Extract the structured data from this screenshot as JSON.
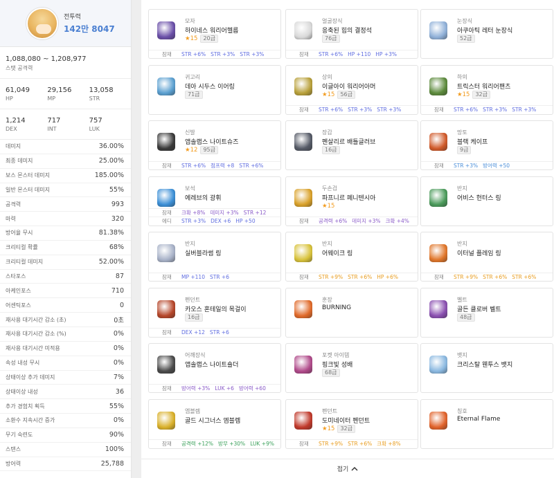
{
  "character": {
    "power_label": "전투력",
    "power_value": "142만 8047"
  },
  "stat_attack": {
    "value": "1,088,080 ~ 1,208,977",
    "label": "스탯 공격력"
  },
  "triples": [
    [
      {
        "value": "61,049",
        "label": "HP"
      },
      {
        "value": "29,156",
        "label": "MP"
      },
      {
        "value": "13,058",
        "label": "STR"
      }
    ],
    [
      {
        "value": "1,214",
        "label": "DEX"
      },
      {
        "value": "717",
        "label": "INT"
      },
      {
        "value": "757",
        "label": "LUK"
      }
    ]
  ],
  "stats": [
    {
      "k": "데미지",
      "v": "36.00%"
    },
    {
      "k": "최종 데미지",
      "v": "25.00%"
    },
    {
      "k": "보스 몬스터 데미지",
      "v": "185.00%"
    },
    {
      "k": "일반 몬스터 데미지",
      "v": "55%"
    },
    {
      "k": "공격력",
      "v": "993"
    },
    {
      "k": "마력",
      "v": "320"
    },
    {
      "k": "방어율 무시",
      "v": "81.38%"
    },
    {
      "k": "크리티컬 확률",
      "v": "68%"
    },
    {
      "k": "크리티컬 데미지",
      "v": "52.00%"
    },
    {
      "k": "스타포스",
      "v": "87"
    },
    {
      "k": "아케인포스",
      "v": "710"
    },
    {
      "k": "어센틱포스",
      "v": "0"
    },
    {
      "k": "재사용 대기시간 감소 (초)",
      "v": "0초"
    },
    {
      "k": "재사용 대기시간 감소 (%)",
      "v": "0%"
    },
    {
      "k": "재사용 대기시간 미적용",
      "v": "0%"
    },
    {
      "k": "속성 내성 무시",
      "v": "0%"
    },
    {
      "k": "상태이상 추가 데미지",
      "v": "7%"
    },
    {
      "k": "상태이상 내성",
      "v": "36"
    },
    {
      "k": "추가 경험치 획득",
      "v": "55%"
    },
    {
      "k": "소환수 지속시간 증가",
      "v": "0%"
    },
    {
      "k": "무기 숙련도",
      "v": "90%"
    },
    {
      "k": "스탠스",
      "v": "100%"
    },
    {
      "k": "방어력",
      "v": "25,788"
    }
  ],
  "equipment": [
    {
      "cat": "모자",
      "name": "하이네스 워리어헬름",
      "star": "★15",
      "lvl": "20급",
      "icon": "hat-icon",
      "icon_color": "#6a4fa8",
      "opts": [
        {
          "t": "잠재",
          "vals": [
            {
              "x": "STR +6%",
              "c": "c-blue"
            },
            {
              "x": "STR +3%",
              "c": "c-blue"
            },
            {
              "x": "STR +3%",
              "c": "c-blue"
            }
          ]
        }
      ]
    },
    {
      "cat": "얼굴장식",
      "name": "응축된 힘의 결정석",
      "star": "",
      "lvl": "76급",
      "icon": "face-accessory-icon",
      "icon_color": "#d9d9d9",
      "opts": [
        {
          "t": "잠재",
          "vals": [
            {
              "x": "STR +6%",
              "c": "c-blue"
            },
            {
              "x": "HP +110",
              "c": "c-blue"
            },
            {
              "x": "HP +3%",
              "c": "c-blue"
            }
          ]
        }
      ]
    },
    {
      "cat": "눈장식",
      "name": "아쿠아틱 레터 눈장식",
      "star": "",
      "lvl": "52급",
      "icon": "eye-accessory-icon",
      "icon_color": "#8fb0d8",
      "opts": []
    },
    {
      "cat": "귀고리",
      "name": "데아 시두스 이어링",
      "star": "",
      "lvl": "71급",
      "icon": "earring-icon",
      "icon_color": "#5a9fd0",
      "opts": []
    },
    {
      "cat": "상의",
      "name": "이글아이 워리어아머",
      "star": "★15",
      "lvl": "56급",
      "icon": "top-armor-icon",
      "icon_color": "#b8a03a",
      "opts": [
        {
          "t": "잠재",
          "vals": [
            {
              "x": "STR +6%",
              "c": "c-blue"
            },
            {
              "x": "STR +3%",
              "c": "c-blue"
            },
            {
              "x": "STR +3%",
              "c": "c-blue"
            }
          ]
        }
      ]
    },
    {
      "cat": "하의",
      "name": "트릭스터 워리어팬츠",
      "star": "★15",
      "lvl": "32급",
      "icon": "pants-icon",
      "icon_color": "#5c8a3c",
      "opts": [
        {
          "t": "잠재",
          "vals": [
            {
              "x": "STR +6%",
              "c": "c-blue"
            },
            {
              "x": "STR +3%",
              "c": "c-blue"
            },
            {
              "x": "STR +3%",
              "c": "c-blue"
            }
          ]
        }
      ]
    },
    {
      "cat": "신발",
      "name": "앱솔랩스 나이트슈즈",
      "star": "★12",
      "lvl": "95급",
      "icon": "shoes-icon",
      "icon_color": "#3a3a3a",
      "opts": [
        {
          "t": "잠재",
          "vals": [
            {
              "x": "STR +6%",
              "c": "c-blue"
            },
            {
              "x": "점프력 +8",
              "c": "c-blue"
            },
            {
              "x": "STR +6%",
              "c": "c-blue"
            }
          ]
        }
      ]
    },
    {
      "cat": "장갑",
      "name": "펜살리르 배틀글러브",
      "star": "",
      "lvl": "16급",
      "icon": "gloves-icon",
      "icon_color": "#555a66",
      "opts": []
    },
    {
      "cat": "망토",
      "name": "블랙 케이프",
      "star": "",
      "lvl": "9급",
      "icon": "cape-icon",
      "icon_color": "#d05a2a",
      "opts": [
        {
          "t": "잠재",
          "vals": [
            {
              "x": "STR +3%",
              "c": "c-sky"
            },
            {
              "x": "방어력 +50",
              "c": "c-sky"
            }
          ]
        }
      ]
    },
    {
      "cat": "보석",
      "name": "에레브의 광휘",
      "star": "",
      "lvl": "",
      "icon": "emblem-gem-icon",
      "icon_color": "#3c8fd6",
      "opts": [
        {
          "t": "잠재",
          "vals": [
            {
              "x": "크확 +8%",
              "c": "c-purple"
            },
            {
              "x": "데미지 +3%",
              "c": "c-purple"
            },
            {
              "x": "STR +12",
              "c": "c-purple"
            }
          ]
        },
        {
          "t": "에디",
          "vals": [
            {
              "x": "STR +3%",
              "c": "c-blue"
            },
            {
              "x": "DEX +6",
              "c": "c-blue"
            },
            {
              "x": "HP +50",
              "c": "c-blue"
            }
          ]
        }
      ]
    },
    {
      "cat": "두손검",
      "name": "파프니르 페니텐시아",
      "star": "★15",
      "lvl": "",
      "icon": "sword-icon",
      "icon_color": "#d9a12a",
      "opts": [
        {
          "t": "잠재",
          "vals": [
            {
              "x": "공격력 +6%",
              "c": "c-purple"
            },
            {
              "x": "데미지 +3%",
              "c": "c-purple"
            },
            {
              "x": "크확 +4%",
              "c": "c-purple"
            }
          ]
        }
      ]
    },
    {
      "cat": "반지",
      "name": "어비스 헌터스 링",
      "star": "",
      "lvl": "",
      "icon": "ring-icon",
      "icon_color": "#4a9a5a",
      "opts": []
    },
    {
      "cat": "반지",
      "name": "실버블라썸 링",
      "star": "",
      "lvl": "",
      "icon": "ring-icon",
      "icon_color": "#a8b2c8",
      "opts": [
        {
          "t": "잠재",
          "vals": [
            {
              "x": "MP +110",
              "c": "c-blue"
            },
            {
              "x": "STR +6",
              "c": "c-blue"
            }
          ]
        }
      ]
    },
    {
      "cat": "반지",
      "name": "어웨이크 링",
      "star": "",
      "lvl": "",
      "icon": "ring-icon",
      "icon_color": "#d8c23a",
      "opts": [
        {
          "t": "잠재",
          "vals": [
            {
              "x": "STR +9%",
              "c": "c-orange"
            },
            {
              "x": "STR +6%",
              "c": "c-orange"
            },
            {
              "x": "HP +6%",
              "c": "c-orange"
            }
          ]
        }
      ]
    },
    {
      "cat": "반지",
      "name": "이터널 플레임 링",
      "star": "",
      "lvl": "",
      "icon": "ring-icon",
      "icon_color": "#e0762a",
      "opts": [
        {
          "t": "잠재",
          "vals": [
            {
              "x": "STR +9%",
              "c": "c-orange"
            },
            {
              "x": "STR +6%",
              "c": "c-orange"
            },
            {
              "x": "STR +6%",
              "c": "c-orange"
            }
          ]
        }
      ]
    },
    {
      "cat": "펜던트",
      "name": "카오스 혼테일의 목걸이",
      "star": "",
      "lvl": "16급",
      "icon": "necklace-icon",
      "icon_color": "#b5462a",
      "opts": [
        {
          "t": "잠재",
          "vals": [
            {
              "x": "DEX +12",
              "c": "c-blue"
            },
            {
              "x": "STR +6",
              "c": "c-blue"
            }
          ]
        }
      ]
    },
    {
      "cat": "훈장",
      "name": "BURNING",
      "star": "",
      "lvl": "",
      "icon": "medal-icon",
      "icon_color": "#e06a2a",
      "opts": []
    },
    {
      "cat": "벨트",
      "name": "골든 클로버 벨트",
      "star": "",
      "lvl": "48급",
      "icon": "belt-icon",
      "icon_color": "#8a4fb0",
      "opts": []
    },
    {
      "cat": "어깨장식",
      "name": "앱솔랩스 나이트숄더",
      "star": "",
      "lvl": "",
      "icon": "shoulder-icon",
      "icon_color": "#4a4a4a",
      "opts": [
        {
          "t": "잠재",
          "vals": [
            {
              "x": "방어력 +3%",
              "c": "c-purple"
            },
            {
              "x": "LUK +6",
              "c": "c-purple"
            },
            {
              "x": "방어력 +60",
              "c": "c-purple"
            }
          ]
        }
      ]
    },
    {
      "cat": "포켓 아이템",
      "name": "핑크빛 성배",
      "star": "",
      "lvl": "68급",
      "icon": "chalice-icon",
      "icon_color": "#b04a8a",
      "opts": []
    },
    {
      "cat": "뱃지",
      "name": "크리스탈 웬투스 뱃지",
      "star": "",
      "lvl": "",
      "icon": "badge-icon",
      "icon_color": "#8ab8e0",
      "opts": []
    },
    {
      "cat": "엠블렘",
      "name": "골드 시그너스 엠블렘",
      "star": "",
      "lvl": "",
      "icon": "emblem-icon",
      "icon_color": "#d9b02a",
      "opts": [
        {
          "t": "잠재",
          "vals": [
            {
              "x": "공격력 +12%",
              "c": "c-green"
            },
            {
              "x": "방무 +30%",
              "c": "c-green"
            },
            {
              "x": "LUK +9%",
              "c": "c-green"
            }
          ]
        }
      ]
    },
    {
      "cat": "펜던트",
      "name": "도미네이터 펜던트",
      "star": "★15",
      "lvl": "32급",
      "icon": "pendant-icon",
      "icon_color": "#c0392b",
      "opts": [
        {
          "t": "잠재",
          "vals": [
            {
              "x": "STR +9%",
              "c": "c-orange"
            },
            {
              "x": "STR +6%",
              "c": "c-orange"
            },
            {
              "x": "크확 +8%",
              "c": "c-orange"
            }
          ]
        }
      ]
    },
    {
      "cat": "칭호",
      "name": "Eternal Flame",
      "star": "",
      "lvl": "",
      "icon": "title-icon",
      "icon_color": "#e0622a",
      "opts": []
    }
  ],
  "fold_button": {
    "label": "접기",
    "icon": "chevron-up-icon"
  }
}
